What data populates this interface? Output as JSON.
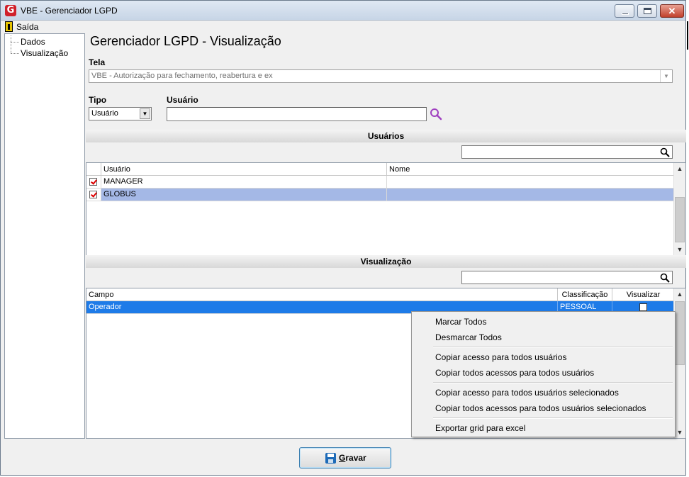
{
  "window": {
    "title": "VBE - Gerenciador LGPD",
    "logo_letter": "G"
  },
  "menu": {
    "exit": "Saída"
  },
  "tree": {
    "items": [
      "Dados",
      "Visualização"
    ]
  },
  "page_title": "Gerenciador LGPD - Visualização",
  "tela": {
    "label": "Tela",
    "value": "VBE - Autorização para fechamento, reabertura e ex"
  },
  "tipo": {
    "label": "Tipo",
    "value": "Usuário"
  },
  "usuario": {
    "label": "Usuário",
    "value": ""
  },
  "users_section": {
    "title": "Usuários",
    "filter_value": "",
    "columns": [
      "Usuário",
      "Nome"
    ],
    "rows": [
      {
        "checked": true,
        "usuario": "MANAGER",
        "nome": ""
      },
      {
        "checked": true,
        "usuario": "GLOBUS",
        "nome": ""
      }
    ]
  },
  "view_section": {
    "title": "Visualização",
    "filter_value": "",
    "columns": [
      "Campo",
      "Classificação",
      "Visualizar"
    ],
    "rows": [
      {
        "campo": "Operador",
        "classificacao": "PESSOAL",
        "visualizar": false
      }
    ]
  },
  "context_menu": {
    "items": [
      "Marcar Todos",
      "Desmarcar Todos",
      "Copiar acesso para todos usuários",
      "Copiar todos acessos para todos usuários",
      "Copiar acesso para todos usuários selecionados",
      "Copiar todos acessos para todos usuários selecionados",
      "Exportar grid para excel"
    ]
  },
  "save_button": {
    "label_first": "G",
    "label_rest": "ravar"
  },
  "colors": {
    "selected_row": "#a4b8e6",
    "highlight_row": "#1e7be8",
    "accent": "#1e6bb8",
    "search_icon": "#a040c0"
  }
}
